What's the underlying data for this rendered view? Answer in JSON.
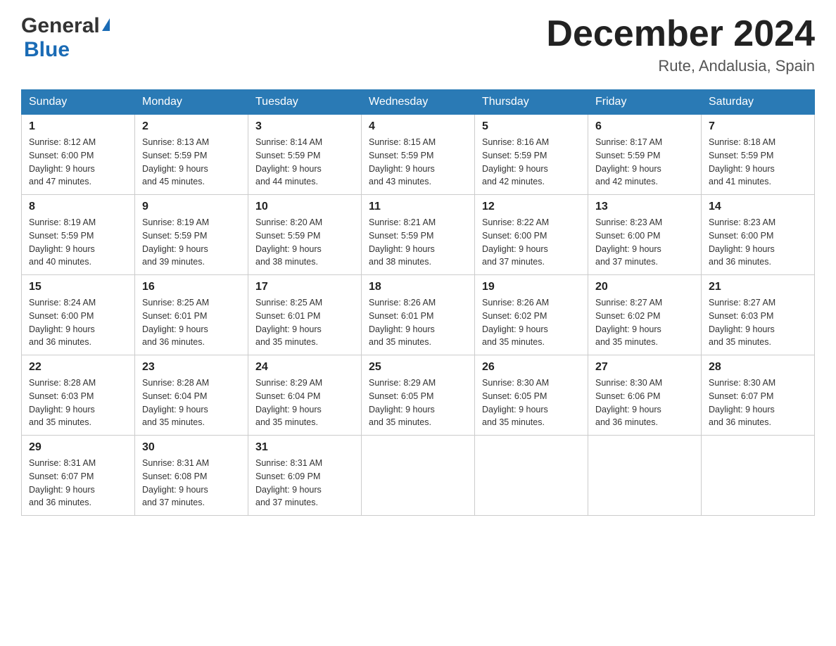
{
  "header": {
    "logo_general": "General",
    "logo_blue": "Blue",
    "month_title": "December 2024",
    "location": "Rute, Andalusia, Spain"
  },
  "days_of_week": [
    "Sunday",
    "Monday",
    "Tuesday",
    "Wednesday",
    "Thursday",
    "Friday",
    "Saturday"
  ],
  "weeks": [
    [
      {
        "day": "1",
        "sunrise": "8:12 AM",
        "sunset": "6:00 PM",
        "daylight": "9 hours and 47 minutes."
      },
      {
        "day": "2",
        "sunrise": "8:13 AM",
        "sunset": "5:59 PM",
        "daylight": "9 hours and 45 minutes."
      },
      {
        "day": "3",
        "sunrise": "8:14 AM",
        "sunset": "5:59 PM",
        "daylight": "9 hours and 44 minutes."
      },
      {
        "day": "4",
        "sunrise": "8:15 AM",
        "sunset": "5:59 PM",
        "daylight": "9 hours and 43 minutes."
      },
      {
        "day": "5",
        "sunrise": "8:16 AM",
        "sunset": "5:59 PM",
        "daylight": "9 hours and 42 minutes."
      },
      {
        "day": "6",
        "sunrise": "8:17 AM",
        "sunset": "5:59 PM",
        "daylight": "9 hours and 42 minutes."
      },
      {
        "day": "7",
        "sunrise": "8:18 AM",
        "sunset": "5:59 PM",
        "daylight": "9 hours and 41 minutes."
      }
    ],
    [
      {
        "day": "8",
        "sunrise": "8:19 AM",
        "sunset": "5:59 PM",
        "daylight": "9 hours and 40 minutes."
      },
      {
        "day": "9",
        "sunrise": "8:19 AM",
        "sunset": "5:59 PM",
        "daylight": "9 hours and 39 minutes."
      },
      {
        "day": "10",
        "sunrise": "8:20 AM",
        "sunset": "5:59 PM",
        "daylight": "9 hours and 38 minutes."
      },
      {
        "day": "11",
        "sunrise": "8:21 AM",
        "sunset": "5:59 PM",
        "daylight": "9 hours and 38 minutes."
      },
      {
        "day": "12",
        "sunrise": "8:22 AM",
        "sunset": "6:00 PM",
        "daylight": "9 hours and 37 minutes."
      },
      {
        "day": "13",
        "sunrise": "8:23 AM",
        "sunset": "6:00 PM",
        "daylight": "9 hours and 37 minutes."
      },
      {
        "day": "14",
        "sunrise": "8:23 AM",
        "sunset": "6:00 PM",
        "daylight": "9 hours and 36 minutes."
      }
    ],
    [
      {
        "day": "15",
        "sunrise": "8:24 AM",
        "sunset": "6:00 PM",
        "daylight": "9 hours and 36 minutes."
      },
      {
        "day": "16",
        "sunrise": "8:25 AM",
        "sunset": "6:01 PM",
        "daylight": "9 hours and 36 minutes."
      },
      {
        "day": "17",
        "sunrise": "8:25 AM",
        "sunset": "6:01 PM",
        "daylight": "9 hours and 35 minutes."
      },
      {
        "day": "18",
        "sunrise": "8:26 AM",
        "sunset": "6:01 PM",
        "daylight": "9 hours and 35 minutes."
      },
      {
        "day": "19",
        "sunrise": "8:26 AM",
        "sunset": "6:02 PM",
        "daylight": "9 hours and 35 minutes."
      },
      {
        "day": "20",
        "sunrise": "8:27 AM",
        "sunset": "6:02 PM",
        "daylight": "9 hours and 35 minutes."
      },
      {
        "day": "21",
        "sunrise": "8:27 AM",
        "sunset": "6:03 PM",
        "daylight": "9 hours and 35 minutes."
      }
    ],
    [
      {
        "day": "22",
        "sunrise": "8:28 AM",
        "sunset": "6:03 PM",
        "daylight": "9 hours and 35 minutes."
      },
      {
        "day": "23",
        "sunrise": "8:28 AM",
        "sunset": "6:04 PM",
        "daylight": "9 hours and 35 minutes."
      },
      {
        "day": "24",
        "sunrise": "8:29 AM",
        "sunset": "6:04 PM",
        "daylight": "9 hours and 35 minutes."
      },
      {
        "day": "25",
        "sunrise": "8:29 AM",
        "sunset": "6:05 PM",
        "daylight": "9 hours and 35 minutes."
      },
      {
        "day": "26",
        "sunrise": "8:30 AM",
        "sunset": "6:05 PM",
        "daylight": "9 hours and 35 minutes."
      },
      {
        "day": "27",
        "sunrise": "8:30 AM",
        "sunset": "6:06 PM",
        "daylight": "9 hours and 36 minutes."
      },
      {
        "day": "28",
        "sunrise": "8:30 AM",
        "sunset": "6:07 PM",
        "daylight": "9 hours and 36 minutes."
      }
    ],
    [
      {
        "day": "29",
        "sunrise": "8:31 AM",
        "sunset": "6:07 PM",
        "daylight": "9 hours and 36 minutes."
      },
      {
        "day": "30",
        "sunrise": "8:31 AM",
        "sunset": "6:08 PM",
        "daylight": "9 hours and 37 minutes."
      },
      {
        "day": "31",
        "sunrise": "8:31 AM",
        "sunset": "6:09 PM",
        "daylight": "9 hours and 37 minutes."
      },
      null,
      null,
      null,
      null
    ]
  ],
  "labels": {
    "sunrise": "Sunrise:",
    "sunset": "Sunset:",
    "daylight": "Daylight:"
  }
}
